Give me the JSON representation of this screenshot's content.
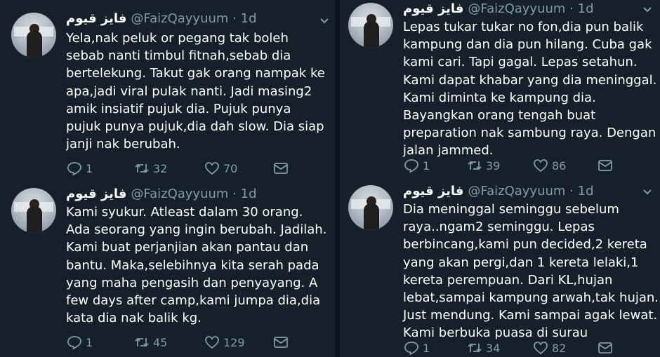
{
  "tweets": [
    {
      "display_name": "فايز قيوم",
      "handle": "@FaizQayyuum",
      "time": "· 1d",
      "text": "Yela,nak peluk or pegang tak boleh\nsebab nanti timbul fitnah,sebab dia\nbertelekung. Takut gak orang nampak ke\napa,jadi viral pulak nanti. Jadi masing2\namik insiatif pujuk dia.  Pujuk punya\npujuk punya pujuk,dia dah slow. Dia siap\njanji nak berubah.",
      "replies": "1",
      "retweets": "32",
      "likes": "70"
    },
    {
      "display_name": "فايز قيوم",
      "handle": "@FaizQayyuum",
      "time": "· 1d",
      "text": "Kami syukur. Atleast dalam 30 orang.\nAda seorang yang ingin berubah. Jadilah.\nKami buat perjanjian akan pantau dan\nbantu. Maka,selebihnya kita serah pada\nyang maha pengasih dan penyayang. A\nfew days after camp,kami jumpa dia,dia\nkata dia nak balik kg.",
      "replies": "1",
      "retweets": "45",
      "likes": "129"
    },
    {
      "display_name": "فايز قيوم",
      "handle": "@FaizQayyuum",
      "time": "· 1d",
      "text": "Lepas tukar tukar no fon,dia pun balik\nkampung dan dia pun hilang. Cuba gak\nkami cari. Tapi gagal. Lepas setahun.\nKami dapat khabar yang dia meninggal.\nKami diminta ke kampung dia.\nBayangkan orang tengah buat\npreparation nak sambung raya. Dengan\njalan jammed.",
      "replies": "1",
      "retweets": "39",
      "likes": "86"
    },
    {
      "display_name": "فايز قيوم",
      "handle": "@FaizQayyuum",
      "time": "· 1d",
      "text": "Dia meninggal seminggu sebelum\nraya..ngam2 seminggu. Lepas\nberbincang,kami pun decided,2 kereta\nyang akan pergi,dan 1 kereta lelaki,1\nkereta perempuan. Dari KL,hujan\nlebat,sampai kampung arwah,tak hujan.\nJust mendung. Kami sampai agak lewat.\nKami berbuka puasa di surau",
      "replies": "1",
      "retweets": "34",
      "likes": "82"
    }
  ],
  "icons": {
    "reply": "reply-icon",
    "retweet": "retweet-icon",
    "like": "heart-icon",
    "dm": "envelope-icon",
    "menu": "chevron-down-icon"
  },
  "colors": {
    "background": "#15202b",
    "secondary_text": "#8899a6",
    "primary_text": "#ffffff"
  }
}
